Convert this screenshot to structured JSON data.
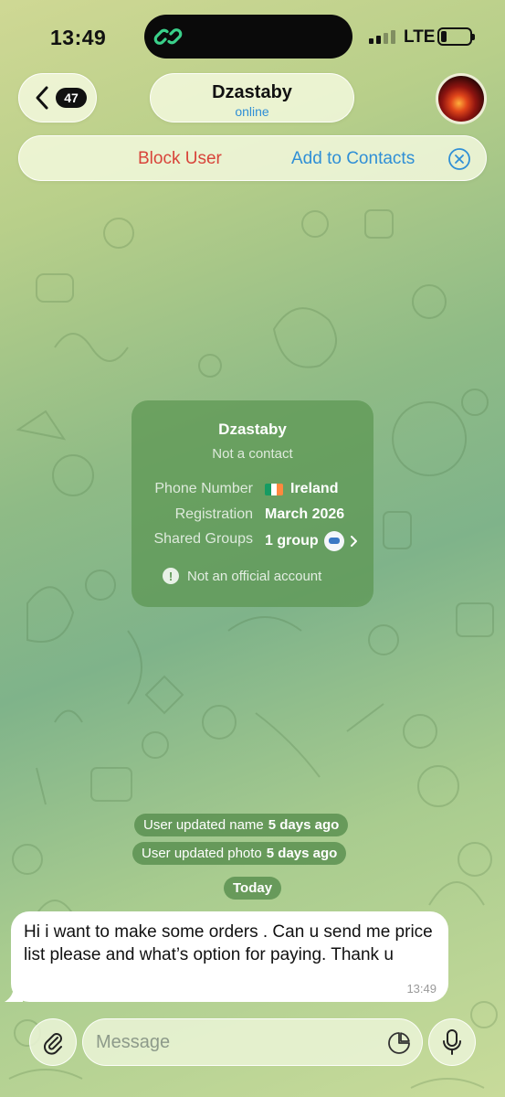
{
  "status_bar": {
    "time": "13:49",
    "network": "LTE",
    "battery_level": 0.2
  },
  "header": {
    "unread_count": "47",
    "chat_name": "Dzastaby",
    "chat_status": "online"
  },
  "action_bar": {
    "block_label": "Block User",
    "add_label": "Add to Contacts"
  },
  "info_card": {
    "name": "Dzastaby",
    "subtitle": "Not a contact",
    "rows": [
      {
        "label": "Phone Number",
        "value": "Ireland"
      },
      {
        "label": "Registration",
        "value": "March 2026"
      },
      {
        "label": "Shared Groups",
        "value": "1 group"
      }
    ],
    "official_note": "Not an official account"
  },
  "service_messages": [
    {
      "text": "User updated name",
      "when": "5 days ago"
    },
    {
      "text": "User updated photo",
      "when": "5 days ago"
    }
  ],
  "date_separator": "Today",
  "message": {
    "text": "Hi i want to make some orders . Can u send me price list please and what’s option for paying. Thank u",
    "time": "13:49"
  },
  "composer": {
    "placeholder": "Message"
  },
  "colors": {
    "accent_blue": "#2f8fd6",
    "destructive_red": "#d8443a",
    "card_green": "#5c9652"
  }
}
